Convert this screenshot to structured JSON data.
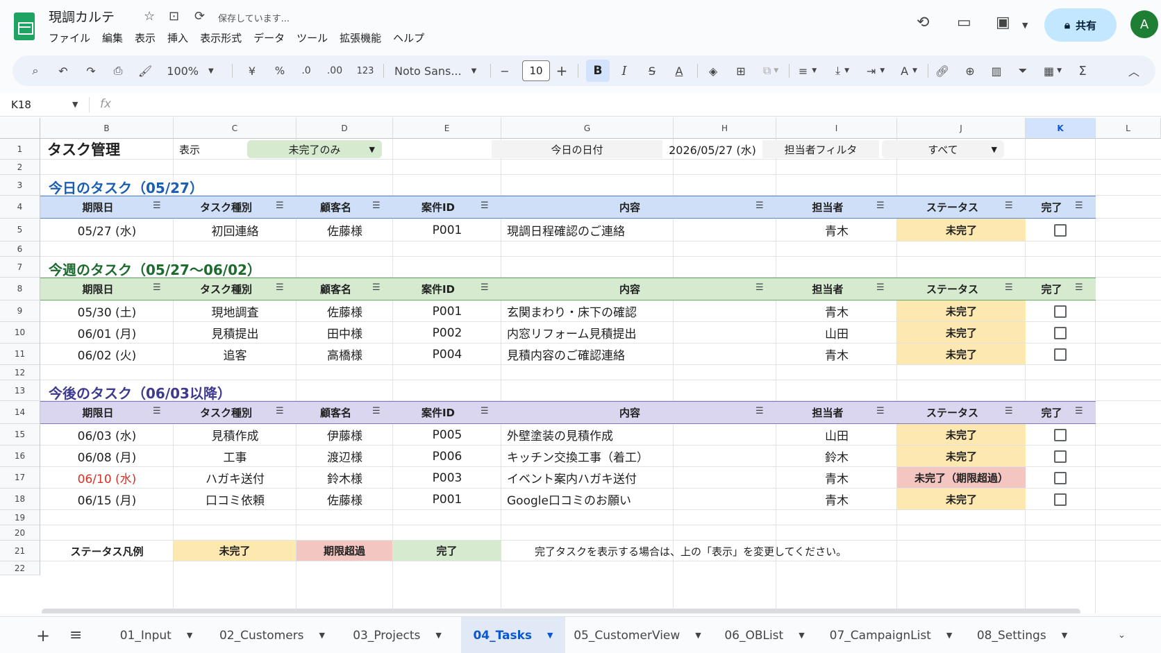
{
  "title_bar": {
    "doc_title": "現調カルテ",
    "saving_status": "保存しています...",
    "menu": [
      "ファイル",
      "編集",
      "表示",
      "挿入",
      "表示形式",
      "データ",
      "ツール",
      "拡張機能",
      "ヘルプ"
    ],
    "share_label": "共有",
    "avatar_letter": "A"
  },
  "toolbar": {
    "zoom": "100%",
    "currency": "¥",
    "percent": "%",
    "dec_decrease": ".0",
    "dec_increase": ".00",
    "number_format": "123",
    "font_name": "Noto Sans...",
    "font_size": "10",
    "minus": "−",
    "plus": "+",
    "bold": "B",
    "italic": "I",
    "sigma": "Σ"
  },
  "formula_bar": {
    "name_box": "K18",
    "fx": "fx"
  },
  "columns": [
    "B",
    "C",
    "D",
    "E",
    "G",
    "H",
    "I",
    "J",
    "K",
    "L"
  ],
  "selected_column": "K",
  "rows": [
    "1",
    "2",
    "3",
    "4",
    "5",
    "6",
    "7",
    "8",
    "9",
    "10",
    "11",
    "12",
    "13",
    "14",
    "15",
    "16",
    "17",
    "18",
    "19",
    "20",
    "21",
    "22"
  ],
  "sheet": {
    "title": "タスク管理",
    "view_label": "表示",
    "view_value": "未完了のみ",
    "today_label": "今日の日付",
    "today_value": "2026/05/27 (水)",
    "assignee_filter_label": "担当者フィルタ",
    "assignee_filter_value": "すべて",
    "headers": [
      "期限日",
      "タスク種別",
      "顧客名",
      "案件ID",
      "内容",
      "担当者",
      "ステータス",
      "完了"
    ],
    "sections": [
      {
        "title": "今日のタスク（05/27）",
        "color": "#1a5fb4",
        "band_bg": "#cfdff7",
        "band_border": "#5b86c9",
        "rows": [
          {
            "date": "05/27 (水)",
            "type": "初回連絡",
            "customer": "佐藤様",
            "id": "P001",
            "content": "現調日程確認のご連絡",
            "assignee": "青木",
            "status": "未完了",
            "overdue": false
          }
        ]
      },
      {
        "title": "今週のタスク（05/27〜06/02）",
        "color": "#1e6b2e",
        "band_bg": "#d5eacf",
        "band_border": "#6aa866",
        "rows": [
          {
            "date": "05/30 (土)",
            "type": "現地調査",
            "customer": "佐藤様",
            "id": "P001",
            "content": "玄関まわり・床下の確認",
            "assignee": "青木",
            "status": "未完了",
            "overdue": false
          },
          {
            "date": "06/01 (月)",
            "type": "見積提出",
            "customer": "田中様",
            "id": "P002",
            "content": "内窓リフォーム見積提出",
            "assignee": "山田",
            "status": "未完了",
            "overdue": false
          },
          {
            "date": "06/02 (火)",
            "type": "追客",
            "customer": "高橋様",
            "id": "P004",
            "content": "見積内容のご確認連絡",
            "assignee": "青木",
            "status": "未完了",
            "overdue": false
          }
        ]
      },
      {
        "title": "今後のタスク（06/03以降）",
        "color": "#3d3a8f",
        "band_bg": "#dad6ef",
        "band_border": "#7f77c0",
        "rows": [
          {
            "date": "06/03 (水)",
            "type": "見積作成",
            "customer": "伊藤様",
            "id": "P005",
            "content": "外壁塗装の見積作成",
            "assignee": "山田",
            "status": "未完了",
            "overdue": false
          },
          {
            "date": "06/08 (月)",
            "type": "工事",
            "customer": "渡辺様",
            "id": "P006",
            "content": "キッチン交換工事（着工）",
            "assignee": "鈴木",
            "status": "未完了",
            "overdue": false
          },
          {
            "date": "06/10 (水)",
            "type": "ハガキ送付",
            "customer": "鈴木様",
            "id": "P003",
            "content": "イベント案内ハガキ送付",
            "assignee": "青木",
            "status": "未完了（期限超過）",
            "overdue": true
          },
          {
            "date": "06/15 (月)",
            "type": "口コミ依頼",
            "customer": "佐藤様",
            "id": "P001",
            "content": "Google口コミのお願い",
            "assignee": "青木",
            "status": "未完了",
            "overdue": false
          }
        ]
      }
    ],
    "legend": {
      "label": "ステータス凡例",
      "items": [
        {
          "label": "未完了",
          "bg": "#fde8b0"
        },
        {
          "label": "期限超過",
          "bg": "#f4c6c2"
        },
        {
          "label": "完了",
          "bg": "#d5eacf"
        }
      ],
      "note": "完了タスクを表示する場合は、上の「表示」を変更してください。"
    }
  },
  "tabs": [
    "01_Input",
    "02_Customers",
    "03_Projects",
    "04_Tasks",
    "05_CustomerView",
    "06_OBList",
    "07_CampaignList",
    "08_Settings"
  ],
  "active_tab": "04_Tasks",
  "colors": {
    "pending": "#fde8b0",
    "overdue": "#f4c6c2",
    "overdue_text": "#d93025",
    "accent": "#0b57d0"
  }
}
